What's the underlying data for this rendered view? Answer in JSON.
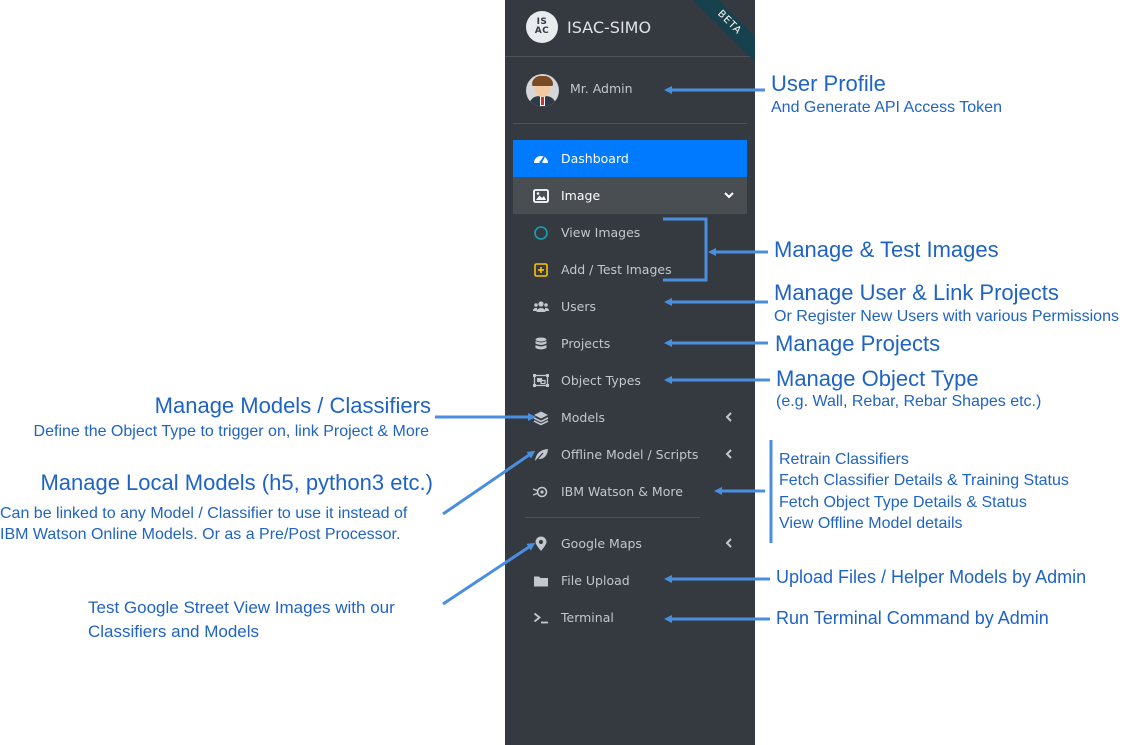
{
  "app": {
    "brand_logo": "IS\nAC",
    "brand_name": "ISAC-SIMO",
    "badge": "BETA"
  },
  "user": {
    "name": "Mr. Admin"
  },
  "nav": {
    "dashboard": {
      "label": "Dashboard",
      "icon": "tachometer-icon"
    },
    "image": {
      "label": "Image",
      "icon": "image-icon",
      "expanded": true
    },
    "view_images": {
      "label": "View Images",
      "icon": "circle-icon"
    },
    "add_test_images": {
      "label": "Add / Test Images",
      "icon": "plus-square-icon"
    },
    "users": {
      "label": "Users",
      "icon": "users-icon"
    },
    "projects": {
      "label": "Projects",
      "icon": "database-icon"
    },
    "object_types": {
      "label": "Object Types",
      "icon": "object-group-icon"
    },
    "models": {
      "label": "Models",
      "icon": "layers-icon"
    },
    "offline_models": {
      "label": "Offline Model / Scripts",
      "icon": "leaf-icon"
    },
    "ibm_watson": {
      "label": "IBM Watson & More",
      "icon": "watson-icon"
    },
    "google_maps": {
      "label": "Google Maps",
      "icon": "map-marker-icon"
    },
    "file_upload": {
      "label": "File Upload",
      "icon": "folder-icon"
    },
    "terminal": {
      "label": "Terminal",
      "icon": "terminal-icon"
    }
  },
  "annotations": {
    "user_profile": {
      "title": "User Profile",
      "sub": "And Generate API Access Token"
    },
    "images": {
      "title": "Manage & Test Images"
    },
    "users": {
      "title": "Manage User & Link Projects",
      "sub": "Or Register New Users with various Permissions"
    },
    "projects": {
      "title": "Manage Projects"
    },
    "object_type": {
      "title": "Manage Object Type",
      "sub": "(e.g. Wall, Rebar, Rebar Shapes etc.)"
    },
    "models": {
      "title": "Manage Models / Classifiers",
      "sub": "Define the Object Type to trigger on, link Project & More"
    },
    "local_models": {
      "title": "Manage Local Models (h5, python3 etc.)",
      "sub1": "Can be linked to any Model / Classifier to use it instead of",
      "sub2": "IBM Watson Online Models. Or as a Pre/Post Processor."
    },
    "watson": {
      "line1": "Retrain Classifiers",
      "line2": "Fetch Classifier Details & Training Status",
      "line3": "Fetch Object Type Details & Status",
      "line4": "View Offline Model details"
    },
    "maps": {
      "line1": "Test Google Street View Images with our",
      "line2": "Classifiers and Models"
    },
    "upload": {
      "title": "Upload Files / Helper Models by Admin"
    },
    "terminal": {
      "title": "Run Terminal Command by Admin"
    }
  },
  "colors": {
    "sidebar_bg": "#343a40",
    "active_bg": "#007bff",
    "annotation": "#1f63c4",
    "arrow": "#4a8ee0"
  }
}
